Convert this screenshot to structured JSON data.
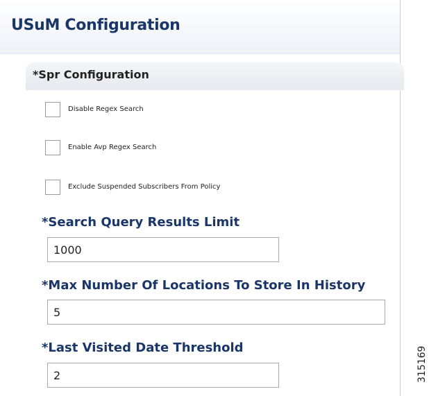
{
  "panel": {
    "title": "USuM Configuration"
  },
  "section": {
    "title": "*Spr Configuration"
  },
  "checkboxes": [
    {
      "label": "Disable Regex Search",
      "checked": false
    },
    {
      "label": "Enable Avp Regex Search",
      "checked": false
    },
    {
      "label": "Exclude Suspended Subscribers From Policy",
      "checked": false
    }
  ],
  "fields": [
    {
      "label": "*Search Query Results Limit",
      "value": "1000"
    },
    {
      "label": "*Max Number Of Locations To Store In History",
      "value": "5"
    },
    {
      "label": "*Last Visited Date Threshold",
      "value": "2"
    }
  ],
  "figure_id": "315169",
  "colors": {
    "title": "#1a3668",
    "text": "#222222",
    "border": "#a8a8a8"
  }
}
